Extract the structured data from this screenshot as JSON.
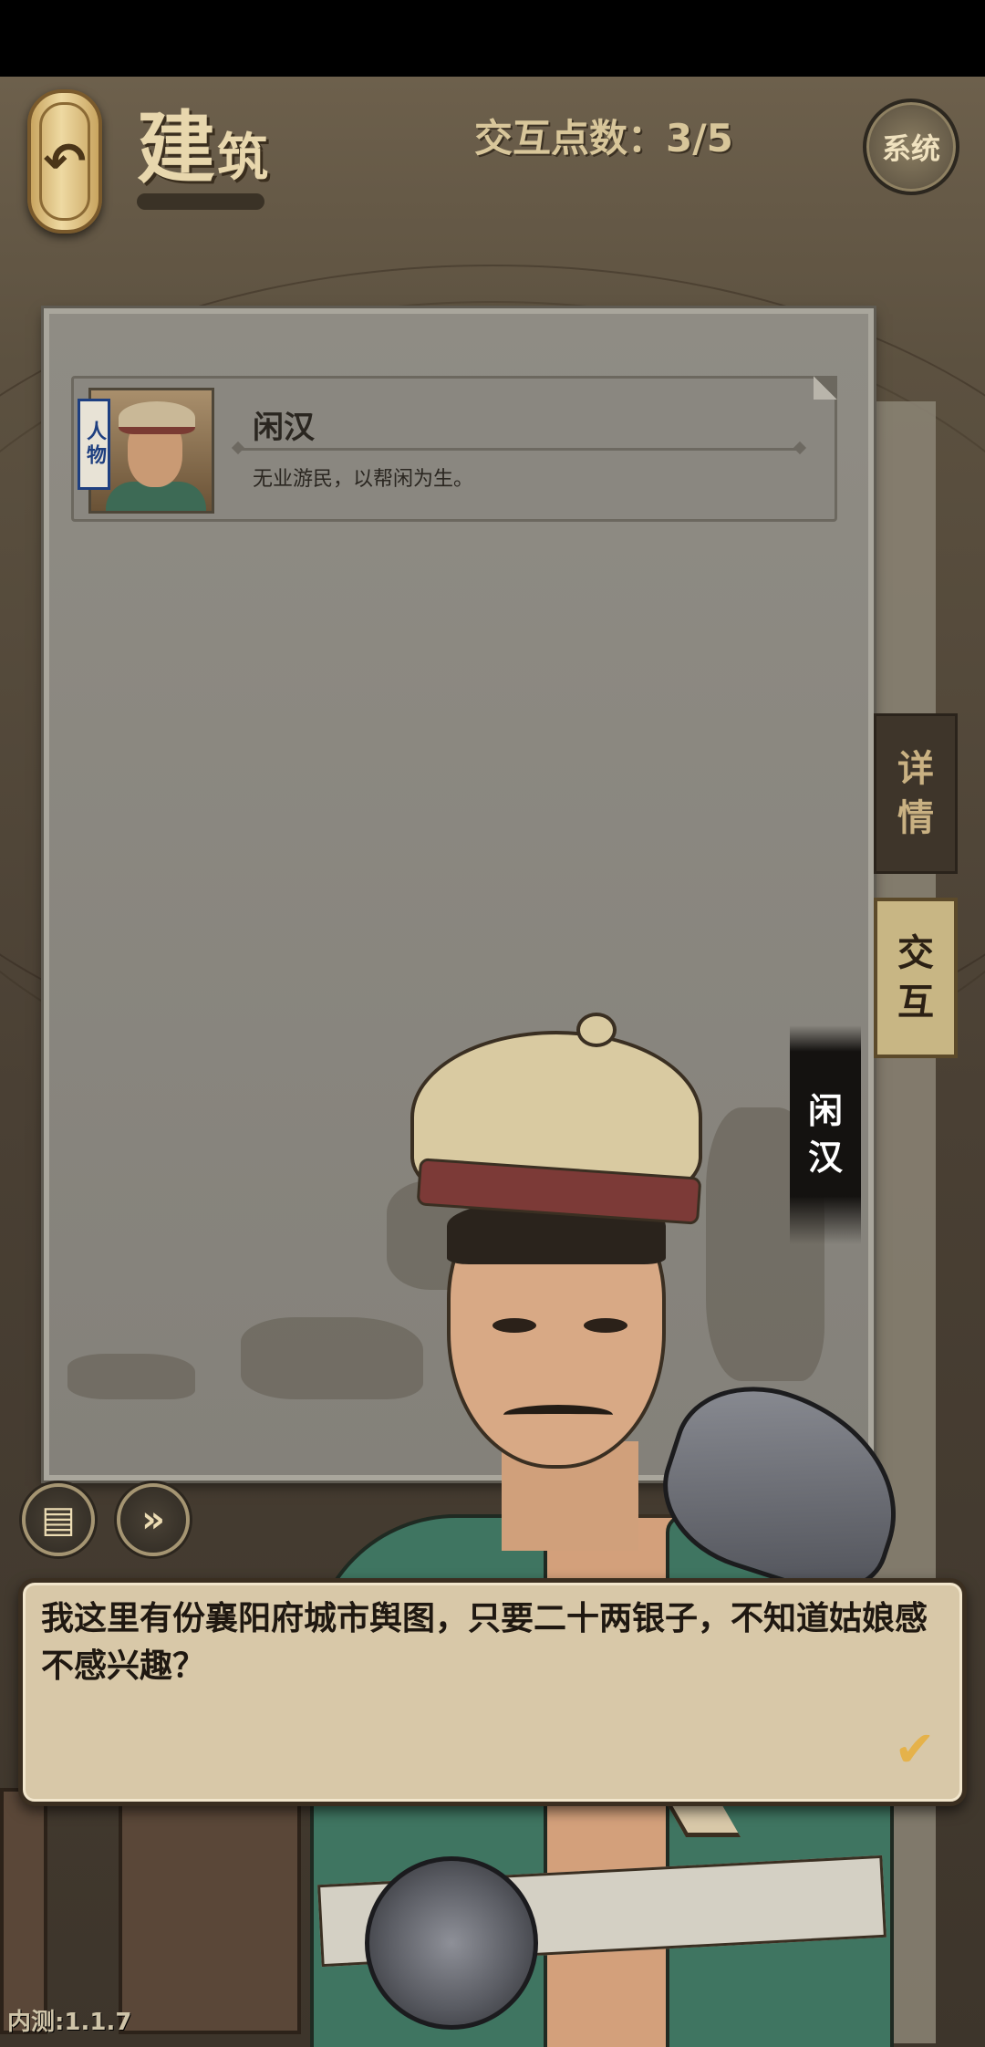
{
  "header": {
    "title_big": "建",
    "title_small": "筑",
    "interaction_points": "交互点数：3/5",
    "system_label": "系统",
    "back_icon": "undo-arrow-icon"
  },
  "character_card": {
    "tag": "人物",
    "name": "闲汉",
    "description": "无业游民，以帮闲为生。"
  },
  "side_tabs": {
    "details": [
      "详",
      "情"
    ],
    "interact": [
      "交",
      "互"
    ]
  },
  "speaker_banner": [
    "闲",
    "汉"
  ],
  "controls": {
    "log_icon": "log-document-icon",
    "skip_icon": "fast-forward-icon"
  },
  "dialog": {
    "text": "我这里有份襄阳府城市舆图，只要二十两银子，不知道姑娘感不感兴趣？",
    "confirm_icon": "checkmark-icon"
  },
  "version": "内测:1.1.7",
  "colors": {
    "panel": "#8f8c84",
    "dialog_bg": "#d8c8a8",
    "accent_gold": "#e5b24a",
    "tab_active": "#c8b684",
    "tab_inactive": "#3e352a"
  }
}
